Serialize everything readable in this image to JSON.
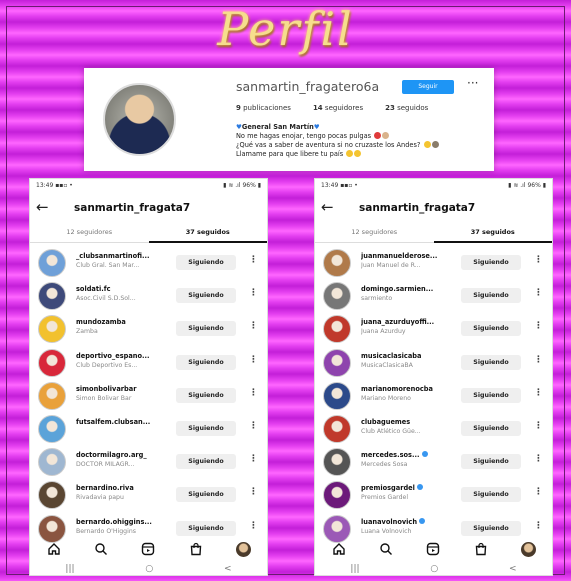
{
  "title": "Perfil",
  "profile": {
    "username": "sanmartin_fragatero6a",
    "follow_label": "Seguir",
    "more": "···",
    "stats": [
      {
        "value": "9",
        "label": "publicaciones"
      },
      {
        "value": "14",
        "label": "seguidores"
      },
      {
        "value": "23",
        "label": "seguidos"
      }
    ],
    "bio_name": "General San Martín",
    "bio_lines": [
      "No me hagas enojar, tengo pocas pulgas",
      "¿Qué vas a saber de aventura si no cruzaste los Andes?",
      "Llamame para que libere tu país"
    ]
  },
  "phone": {
    "status_time": "13:49",
    "status_right": "96%",
    "header_title": "sanmartin_fragata7",
    "tab_followers": "12 seguidores",
    "tab_following": "37 seguidos",
    "following_label": "Siguiendo",
    "sys_nav": [
      "|||",
      "○",
      "<"
    ]
  },
  "left_list": [
    {
      "name": "_clubsanmartinofi...",
      "sub": "Club Gral. San Mar...",
      "color": "#6fa0d8"
    },
    {
      "name": "soldati.fc",
      "sub": "Asoc.Civil S.D.Sol...",
      "color": "#3e4a7a"
    },
    {
      "name": "mundozamba",
      "sub": "Zamba",
      "color": "#f2c12e"
    },
    {
      "name": "deportivo_espano...",
      "sub": "Club Deportivo Es...",
      "color": "#d8283a"
    },
    {
      "name": "simonbolivarbar",
      "sub": "Simon Bolivar Bar",
      "color": "#e9a13b"
    },
    {
      "name": "futsalfem.clubsan...",
      "sub": "",
      "color": "#5ba3d9"
    },
    {
      "name": "doctormilagro.arg_",
      "sub": "DOCTOR MILAGR...",
      "color": "#9fb7d1"
    },
    {
      "name": "bernardino.riva",
      "sub": "Rivadavia papu",
      "color": "#5a4632"
    },
    {
      "name": "bernardo.ohiggins...",
      "sub": "Bernardo O'Higgins",
      "color": "#8a5540"
    }
  ],
  "right_list": [
    {
      "name": "juanmanuelderose...",
      "sub": "Juan Manuel de R...",
      "color": "#b07a4a",
      "verified": false
    },
    {
      "name": "domingo.sarmien...",
      "sub": "sarmiento",
      "color": "#777777",
      "verified": false
    },
    {
      "name": "juana_azurduyoffi...",
      "sub": "Juana Azurduy",
      "color": "#c0392b",
      "verified": false
    },
    {
      "name": "musicaclasicaba",
      "sub": "MusicaClasicaBA",
      "color": "#8e44ad",
      "verified": false
    },
    {
      "name": "marianomorenocba",
      "sub": "Mariano Moreno",
      "color": "#2c4a8a",
      "verified": false
    },
    {
      "name": "clubaguemes",
      "sub": "Club Atlético Güe...",
      "color": "#c0392b",
      "verified": false
    },
    {
      "name": "mercedes.sos...",
      "sub": "Mercedes Sosa",
      "color": "#555555",
      "verified": true
    },
    {
      "name": "premiosgardel",
      "sub": "Premios Gardel",
      "color": "#6c1a7a",
      "verified": true
    },
    {
      "name": "luanavolnovich",
      "sub": "Luana Volnovich",
      "color": "#9b59b6",
      "verified": true
    }
  ],
  "icons": [
    "home-icon",
    "search-icon",
    "reels-icon",
    "shop-icon",
    "profile-avatar"
  ]
}
